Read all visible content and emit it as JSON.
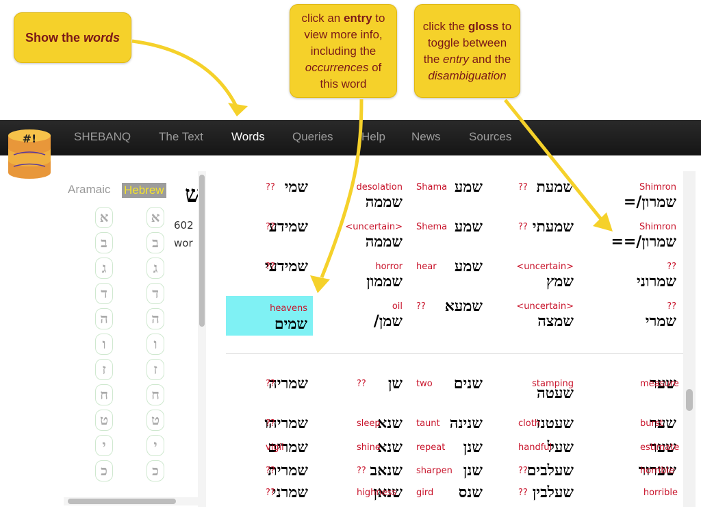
{
  "callouts": {
    "show_words": {
      "pre": "Show the ",
      "em": "words"
    },
    "entry": {
      "pre": "click an ",
      "bold": "entry",
      "mid1": " to view more info, including the ",
      "em": "occurrences",
      "post": " of this word"
    },
    "gloss": {
      "pre": "click the ",
      "bold": "gloss",
      "mid1": " to toggle between the ",
      "em1": "entry",
      "mid2": " and the ",
      "em2": "disambiguation"
    }
  },
  "navbar": {
    "items": [
      "SHEBANQ",
      "The Text",
      "Words",
      "Queries",
      "Help",
      "News",
      "Sources"
    ],
    "active": "Words"
  },
  "left_pane": {
    "languages": [
      "Aramaic",
      "Hebrew"
    ],
    "selected_language": "Hebrew",
    "letters": [
      "א",
      "ב",
      "ג",
      "ד",
      "ה",
      "ו",
      "ז",
      "ח",
      "ט",
      "י",
      "כ"
    ],
    "info": {
      "letter": "ש",
      "count": "602",
      "label": "wor"
    }
  },
  "entries": [
    {
      "hebrew": "שמי",
      "gloss": "??"
    },
    {
      "hebrew": "שממה",
      "gloss": "desolation"
    },
    {
      "hebrew": "שמע",
      "gloss": "Shama"
    },
    {
      "hebrew": "שמעת",
      "gloss": "??"
    },
    {
      "hebrew": "שמרון/=",
      "gloss": "Shimron"
    },
    {
      "hebrew": "שמידע",
      "gloss": "??"
    },
    {
      "hebrew": "שממה",
      "gloss": "<uncertain>"
    },
    {
      "hebrew": "שמע",
      "gloss": "Shema"
    },
    {
      "hebrew": "שמעתי",
      "gloss": "??"
    },
    {
      "hebrew": "שמרון/==",
      "gloss": "Shimron"
    },
    {
      "hebrew": "שמידעי",
      "gloss": "??"
    },
    {
      "hebrew": "שממון",
      "gloss": "horror"
    },
    {
      "hebrew": "שמע",
      "gloss": "hear"
    },
    {
      "hebrew": "שמץ",
      "gloss": "<uncertain>"
    },
    {
      "hebrew": "שמרוני",
      "gloss": "??"
    },
    {
      "hebrew": "שמים",
      "gloss": "heavens"
    },
    {
      "hebrew": "שמן/",
      "gloss": "oil"
    },
    {
      "hebrew": "שמעא",
      "gloss": "??"
    },
    {
      "hebrew": "שמצה",
      "gloss": "<uncertain>"
    },
    {
      "hebrew": "שמרי",
      "gloss": "??"
    },
    {
      "hebrew": "שמריה",
      "gloss": "??"
    },
    {
      "hebrew": "שן",
      "gloss": "??"
    },
    {
      "hebrew": "שנים",
      "gloss": "two"
    },
    {
      "hebrew": "שעטה",
      "gloss": "stamping"
    },
    {
      "hebrew": "שער",
      "gloss": "measure"
    },
    {
      "hebrew": "שמריהו",
      "gloss": "??"
    },
    {
      "hebrew": "שנא",
      "gloss": "sleep"
    },
    {
      "hebrew": "שנינה",
      "gloss": "taunt"
    },
    {
      "hebrew": "שעטנז",
      "gloss": "cloth"
    },
    {
      "hebrew": "שער",
      "gloss": "burst"
    },
    {
      "hebrew": "שמרים",
      "gloss": "vigil"
    },
    {
      "hebrew": "שנא",
      "gloss": "shine"
    },
    {
      "hebrew": "שנן",
      "gloss": "repeat"
    },
    {
      "hebrew": "שעל",
      "gloss": "handful"
    },
    {
      "hebrew": "שער",
      "gloss": "estimate"
    },
    {
      "hebrew": "שמרית",
      "gloss": "??"
    },
    {
      "hebrew": "שנאב",
      "gloss": "??"
    },
    {
      "hebrew": "שנן",
      "gloss": "sharpen"
    },
    {
      "hebrew": "שעלבים",
      "gloss": "??"
    },
    {
      "hebrew": "שערור",
      "gloss": "horrible"
    },
    {
      "hebrew": "שמרני",
      "gloss": "??"
    },
    {
      "hebrew": "שנאן",
      "gloss": "highness"
    },
    {
      "hebrew": "שנס",
      "gloss": "gird"
    },
    {
      "hebrew": "שעלבין",
      "gloss": "??"
    },
    {
      "hebrew": "",
      "gloss": "horrible"
    }
  ],
  "highlighted_entry": 15,
  "colors": {
    "navbar": "#1c1c1c",
    "callout": "#f5d12a",
    "gloss": "#c8132a",
    "highlight": "#7ff1f4",
    "hebrew_tab_text": "#f3e22e"
  }
}
